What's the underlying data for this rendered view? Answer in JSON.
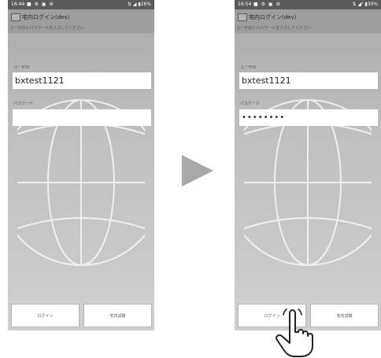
{
  "screens": [
    {
      "status_time": "16:44",
      "status_right": "⇅ ◢ ▮26%",
      "app_title": "宅内ログイン(dev)",
      "subtitle": "ユーザIDとパスワードを入力してください",
      "user_label": "ユーザID",
      "user_value": "bxtest1121",
      "pass_label": "パスワード",
      "pass_value": "",
      "login_button": "ログイン",
      "demo_button": "宅内試験"
    },
    {
      "status_time": "16:54",
      "status_right": "⇅ ◢¹ ▮30%",
      "app_title": "宅内ログイン(dev)",
      "subtitle": "ユーザIDとパスワードを入力してください",
      "user_label": "ユーザID",
      "user_value": "bxtest1121",
      "pass_label": "パスワード",
      "pass_value": "••••••••",
      "login_button": "ログイン",
      "demo_button": "宅内試験"
    }
  ],
  "icons": [
    "notification-icons",
    "app-icon",
    "globe-watermark",
    "next-arrow-icon",
    "tap-hand-icon"
  ]
}
